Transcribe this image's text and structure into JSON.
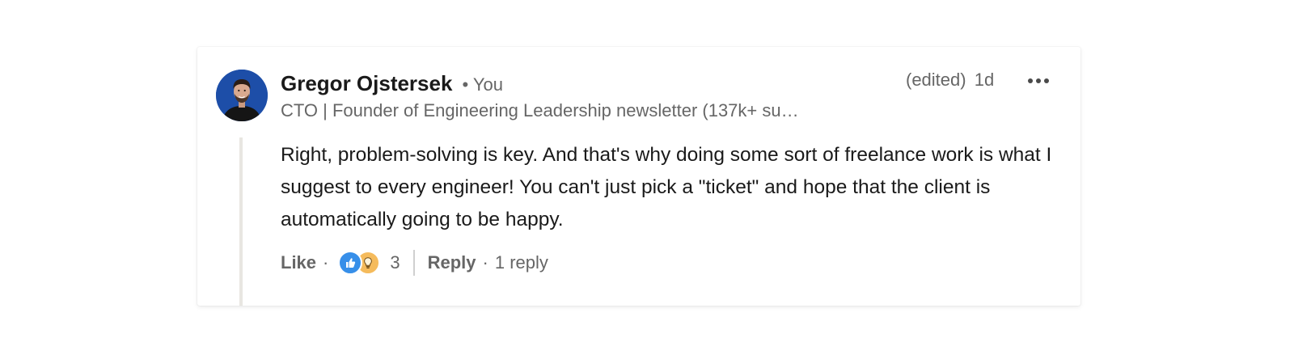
{
  "comment": {
    "author": "Gregor Ojstersek",
    "relation": "• You",
    "headline": "CTO | Founder of Engineering Leadership newsletter (137k+ su…",
    "edited_label": "(edited)",
    "age": "1d",
    "body": "Right, problem-solving is key. And that's why doing some sort of freelance work is what I suggest to every engineer! You can't just pick a \"ticket\" and hope that the client is automatically going to be happy.",
    "actions": {
      "like_label": "Like",
      "separator": "·",
      "reaction_icons": [
        "like-icon",
        "insightful-lightbulb-icon"
      ],
      "reaction_count": "3",
      "reply_label": "Reply",
      "reply_count": "1 reply"
    }
  },
  "colors": {
    "avatar_bg": "#1d4ea8",
    "like_reaction": "#378fe9",
    "insight_reaction": "#f5bb5c",
    "muted_text": "#666666"
  }
}
